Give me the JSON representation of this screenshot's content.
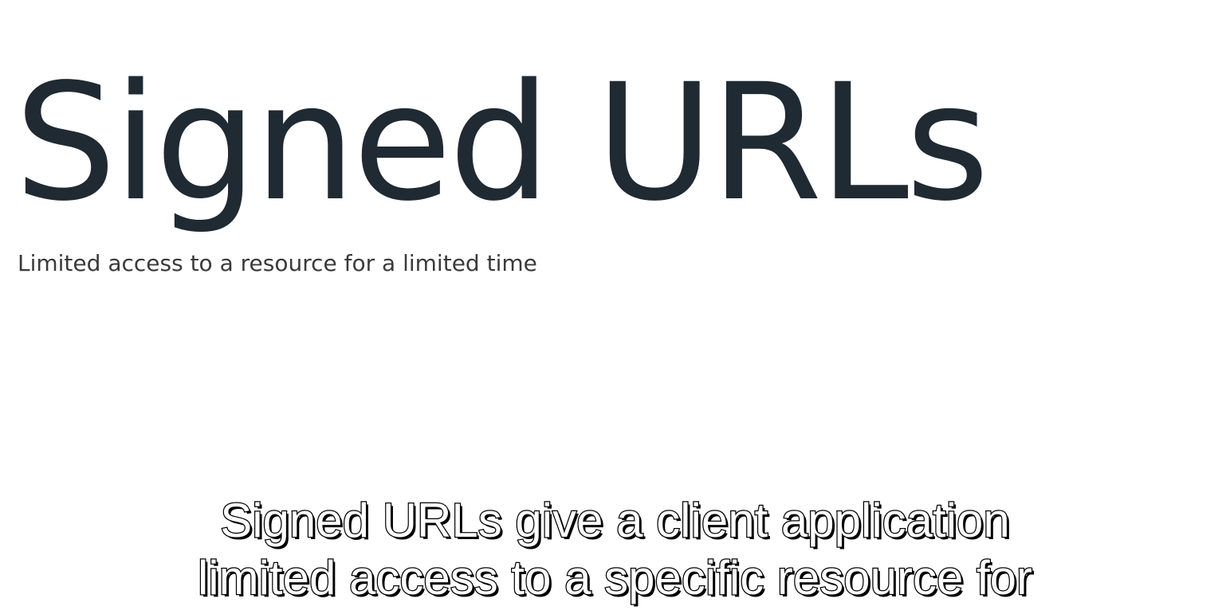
{
  "slide": {
    "title": "Signed URLs",
    "subtitle": "Limited access to a resource for a limited time"
  },
  "caption": {
    "lines": [
      "Signed URLs give a client application",
      "limited access to a specific resource for"
    ]
  }
}
